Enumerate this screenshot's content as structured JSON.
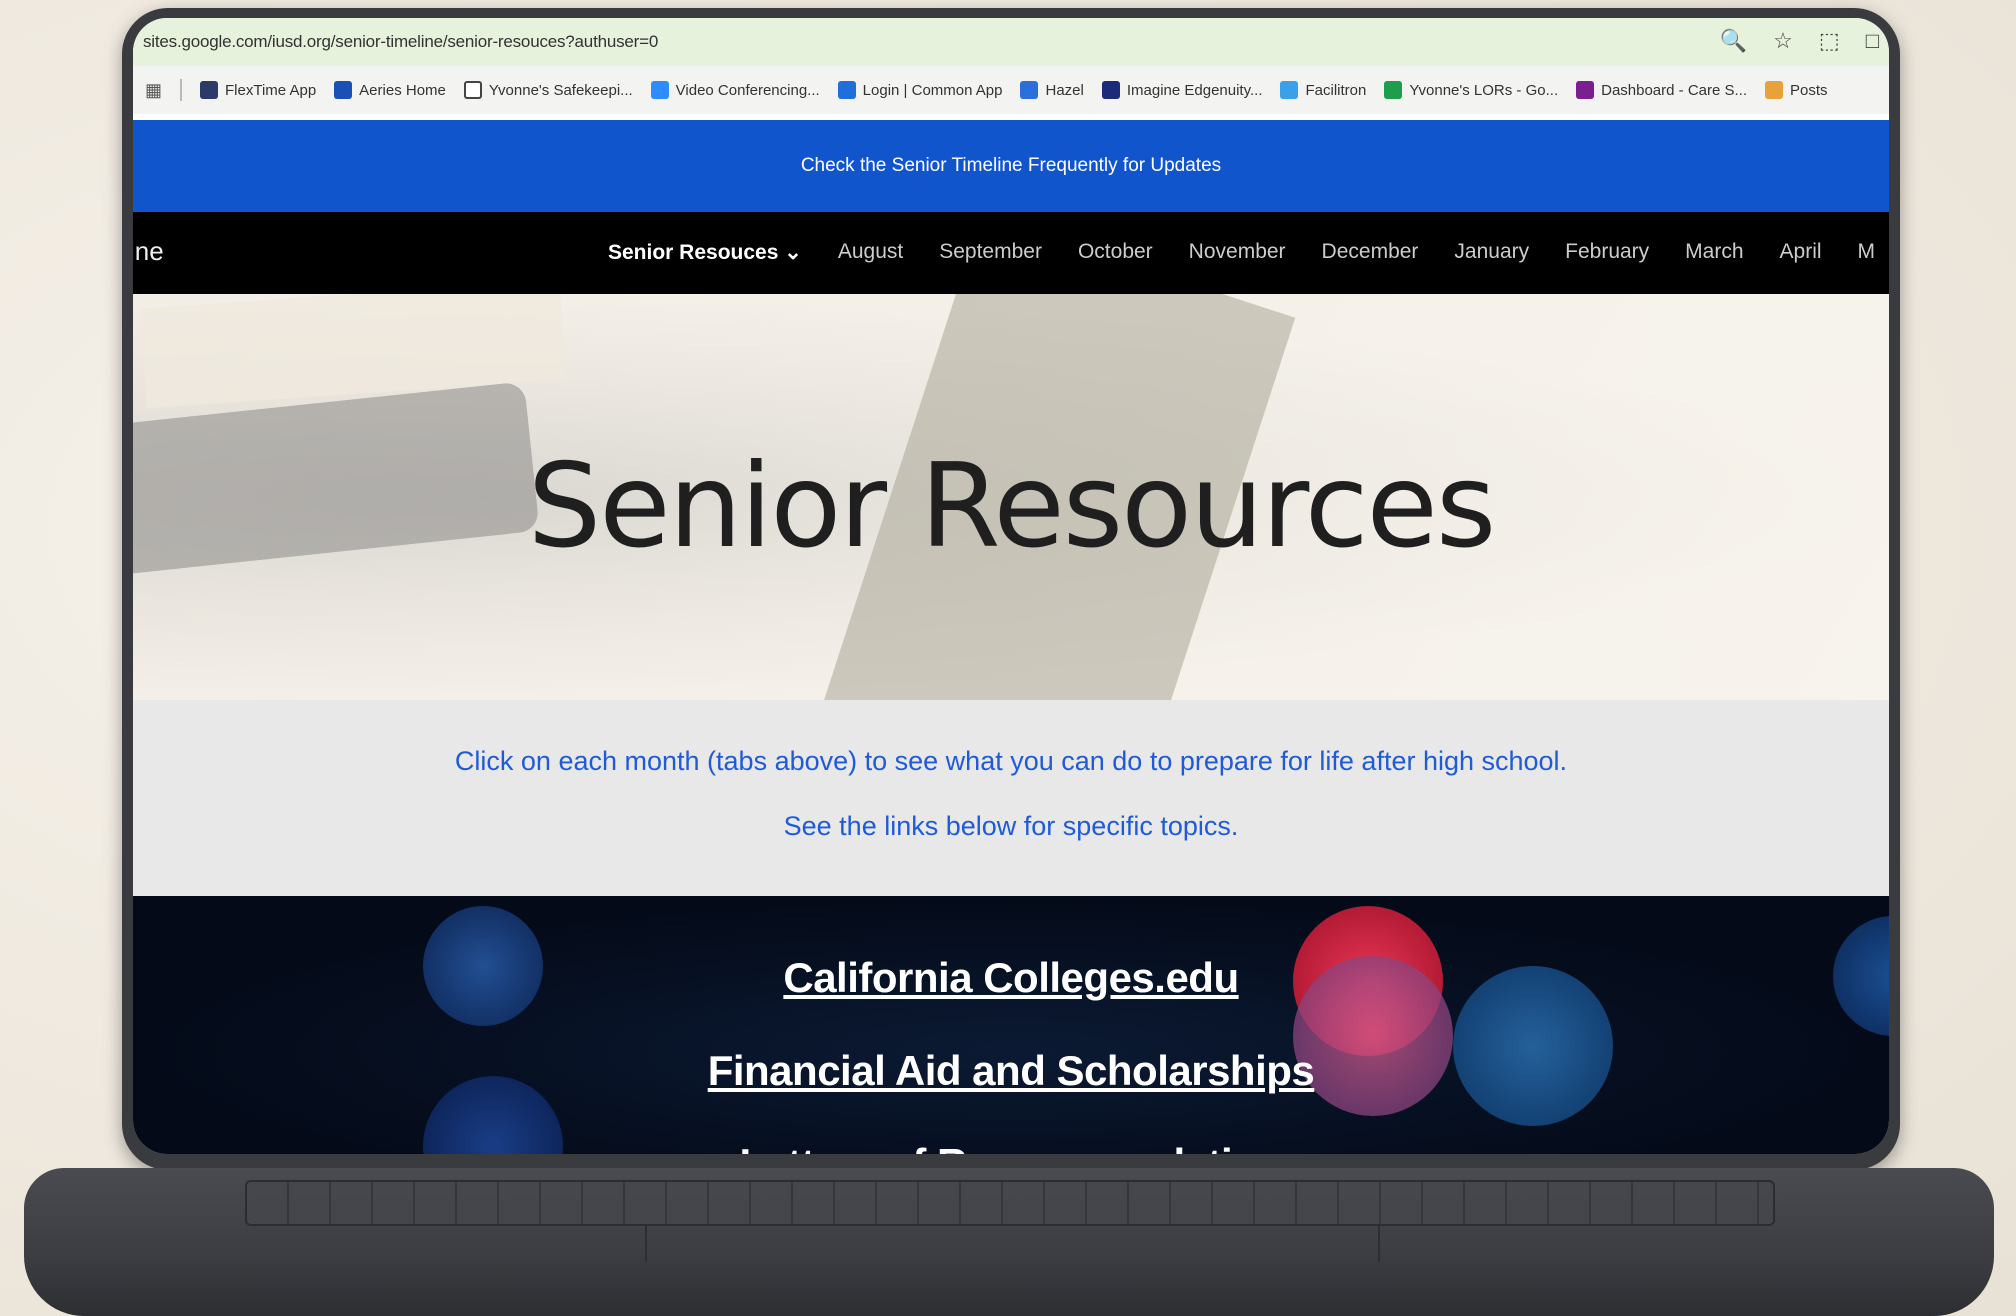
{
  "browser": {
    "url": "sites.google.com/iusd.org/senior-timeline/senior-resouces?authuser=0",
    "bookmarks": [
      {
        "label": "FlexTime App",
        "icon": "flextime-icon",
        "color": "#2b3a67"
      },
      {
        "label": "Aeries Home",
        "icon": "aeries-icon",
        "color": "#1a4fb3"
      },
      {
        "label": "Yvonne's Safekeepi...",
        "icon": "folder-icon",
        "color": "#ffffff"
      },
      {
        "label": "Video Conferencing...",
        "icon": "zoom-icon",
        "color": "#2d8cff"
      },
      {
        "label": "Login | Common App",
        "icon": "commonapp-icon",
        "color": "#1e6fd9"
      },
      {
        "label": "Hazel",
        "icon": "hazel-icon",
        "color": "#2a6fdc"
      },
      {
        "label": "Imagine Edgenuity...",
        "icon": "edgenuity-icon",
        "color": "#1c2a7a"
      },
      {
        "label": "Facilitron",
        "icon": "facilitron-icon",
        "color": "#3aa0e8"
      },
      {
        "label": "Yvonne's LORs - Go...",
        "icon": "sheets-icon",
        "color": "#1e9e4b"
      },
      {
        "label": "Dashboard - Care S...",
        "icon": "dashboard-icon",
        "color": "#7a1f8f"
      },
      {
        "label": "Posts",
        "icon": "posts-icon",
        "color": "#e9a23b"
      }
    ]
  },
  "site": {
    "banner_text": "Check the Senior Timeline Frequently for Updates",
    "brand_fragment": "ine",
    "nav": [
      "Senior Resouces",
      "August",
      "September",
      "October",
      "November",
      "December",
      "January",
      "February",
      "March",
      "April",
      "M"
    ],
    "active_nav": "Senior Resouces",
    "hero_title": "Senior Resources",
    "info_lines": [
      "Click on each month (tabs above) to see what you can do to prepare for life after high school.",
      "See the links below for specific topics."
    ],
    "links": [
      "California Colleges.edu",
      "Financial Aid and Scholarships",
      "Letters of Recommendation"
    ]
  },
  "colors": {
    "banner": "#1155cc",
    "nav_bg": "#000000",
    "info_text": "#1f5bd6",
    "info_bg": "#e8e8e8"
  }
}
